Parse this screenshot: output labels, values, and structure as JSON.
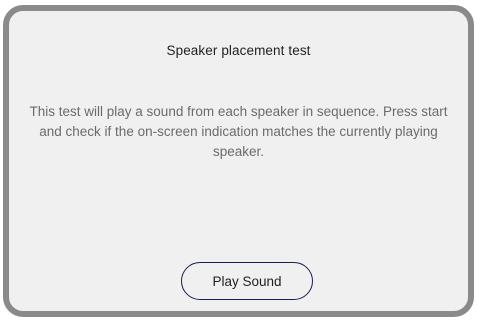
{
  "dialog": {
    "title": "Speaker placement test",
    "description": "This test will play a sound from each speaker in sequence. Press start and check if the on-screen indication matches the currently playing speaker.",
    "play_button_label": "Play Sound"
  },
  "colors": {
    "background": "#f0f0f0",
    "border": "#8a8a8a",
    "button_border": "#1b1f4d",
    "title_text": "#1f1f1f",
    "body_text": "#6b6b6b"
  }
}
